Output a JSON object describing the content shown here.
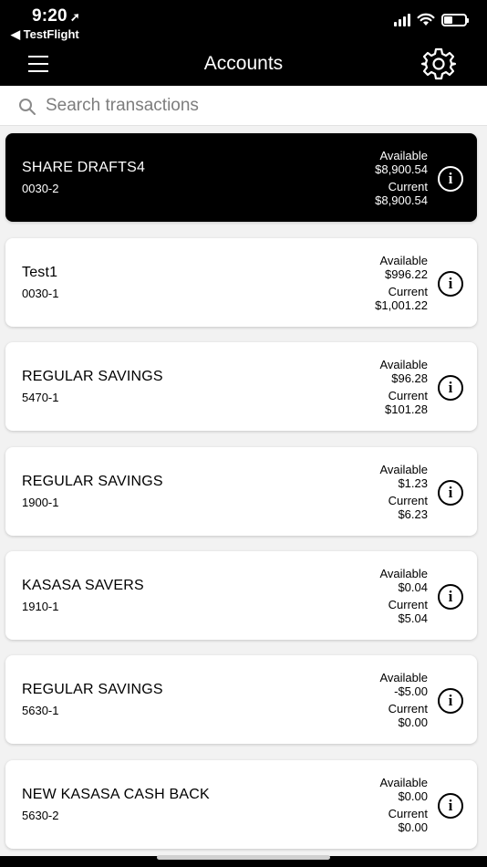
{
  "status_bar": {
    "time": "9:20",
    "back_label": "◀ TestFlight"
  },
  "nav": {
    "title": "Accounts"
  },
  "search": {
    "placeholder": "Search transactions"
  },
  "accounts": [
    {
      "name": "SHARE DRAFTS4",
      "number": "0030-2",
      "available_label": "Available",
      "available": "$8,900.54",
      "current_label": "Current",
      "current": "$8,900.54",
      "selected": true
    },
    {
      "name": "Test1",
      "number": "0030-1",
      "available_label": "Available",
      "available": "$996.22",
      "current_label": "Current",
      "current": "$1,001.22"
    },
    {
      "name": "REGULAR SAVINGS",
      "number": "5470-1",
      "available_label": "Available",
      "available": "$96.28",
      "current_label": "Current",
      "current": "$101.28"
    },
    {
      "name": "REGULAR SAVINGS",
      "number": "1900-1",
      "available_label": "Available",
      "available": "$1.23",
      "current_label": "Current",
      "current": "$6.23"
    },
    {
      "name": "KASASA SAVERS",
      "number": "1910-1",
      "available_label": "Available",
      "available": "$0.04",
      "current_label": "Current",
      "current": "$5.04"
    },
    {
      "name": "REGULAR SAVINGS",
      "number": "5630-1",
      "available_label": "Available",
      "available": "-$5.00",
      "current_label": "Current",
      "current": "$0.00"
    },
    {
      "name": "NEW KASASA CASH BACK",
      "number": "5630-2",
      "available_label": "Available",
      "available": "$0.00",
      "current_label": "Current",
      "current": "$0.00"
    }
  ],
  "colors": {
    "header_background": "#000000",
    "selected_card": "#000000",
    "card": "#ffffff",
    "page_background": "#f2f2f2"
  }
}
